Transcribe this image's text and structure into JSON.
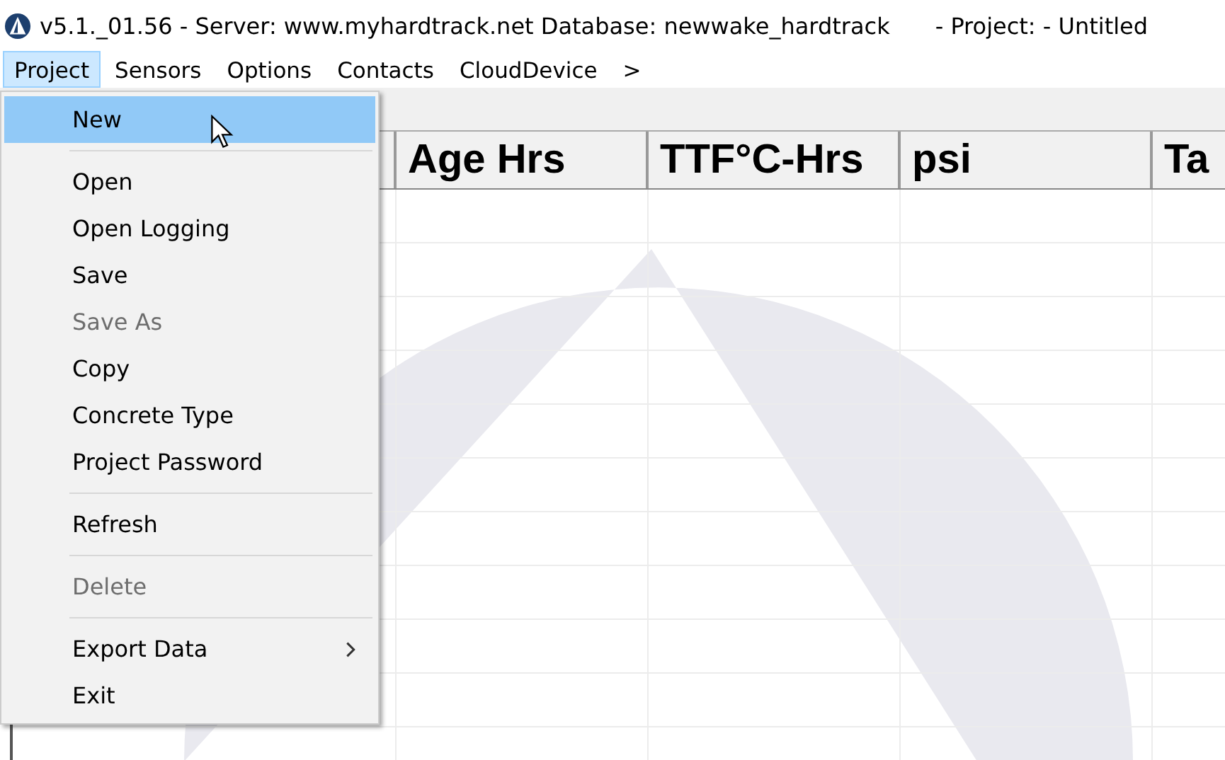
{
  "window": {
    "title": "v5.1._01.56 - Server: www.myhardtrack.net Database: newwake_hardtrack",
    "project": "- Project: - Untitled"
  },
  "menu_bar": [
    {
      "label": "Project",
      "selected": true
    },
    {
      "label": "Sensors",
      "selected": false
    },
    {
      "label": "Options",
      "selected": false
    },
    {
      "label": "Contacts",
      "selected": false
    },
    {
      "label": "CloudDevice",
      "selected": false
    },
    {
      "label": ">",
      "selected": false
    }
  ],
  "project_menu": [
    {
      "kind": "item",
      "label": "New",
      "selected": true,
      "disabled": false,
      "submenu": false
    },
    {
      "kind": "separator"
    },
    {
      "kind": "item",
      "label": "Open",
      "selected": false,
      "disabled": false,
      "submenu": false
    },
    {
      "kind": "item",
      "label": "Open Logging",
      "selected": false,
      "disabled": false,
      "submenu": false
    },
    {
      "kind": "item",
      "label": "Save",
      "selected": false,
      "disabled": false,
      "submenu": false
    },
    {
      "kind": "item",
      "label": "Save As",
      "selected": false,
      "disabled": true,
      "submenu": false
    },
    {
      "kind": "item",
      "label": "Copy",
      "selected": false,
      "disabled": false,
      "submenu": false
    },
    {
      "kind": "item",
      "label": "Concrete Type",
      "selected": false,
      "disabled": false,
      "submenu": false
    },
    {
      "kind": "item",
      "label": "Project Password",
      "selected": false,
      "disabled": false,
      "submenu": false
    },
    {
      "kind": "separator"
    },
    {
      "kind": "item",
      "label": "Refresh",
      "selected": false,
      "disabled": false,
      "submenu": false
    },
    {
      "kind": "separator"
    },
    {
      "kind": "item",
      "label": "Delete",
      "selected": false,
      "disabled": true,
      "submenu": false
    },
    {
      "kind": "separator"
    },
    {
      "kind": "item",
      "label": "Export Data",
      "selected": false,
      "disabled": false,
      "submenu": true
    },
    {
      "kind": "item",
      "label": "Exit",
      "selected": false,
      "disabled": false,
      "submenu": false
    }
  ],
  "table": {
    "columns": [
      "Age Hrs",
      "TTF°C-Hrs",
      "psi",
      "Ta"
    ]
  }
}
